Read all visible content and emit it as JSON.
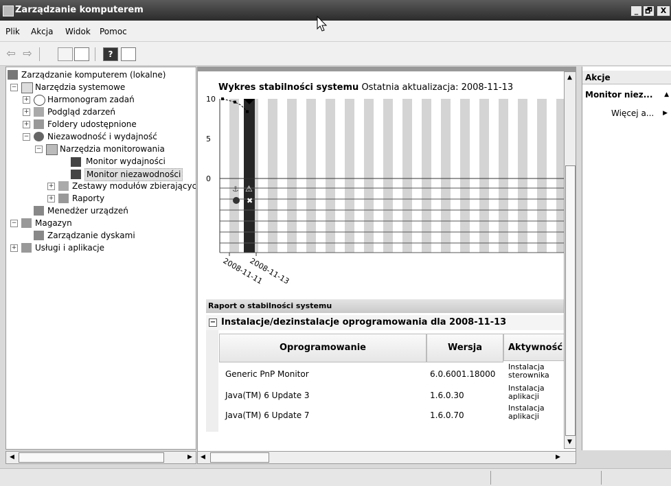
{
  "window": {
    "title": "Zarządzanie komputerem",
    "buttons": {
      "min": "_",
      "max": "🗗",
      "close": "X"
    }
  },
  "menu": [
    "Plik",
    "Akcja",
    "Widok",
    "Pomoc"
  ],
  "toolbar": {
    "back_icon": "back-arrow-icon",
    "forward_icon": "forward-arrow-icon"
  },
  "tree": {
    "items": [
      {
        "label": "Zarządzanie komputerem (lokalne)"
      },
      {
        "label": "Narzędzia systemowe"
      },
      {
        "label": "Harmonogram zadań"
      },
      {
        "label": "Podgląd zdarzeń"
      },
      {
        "label": "Foldery udostępnione"
      },
      {
        "label": "Niezawodność i wydajność"
      },
      {
        "label": "Narzędzia monitorowania"
      },
      {
        "label": "Monitor wydajności"
      },
      {
        "label": "Monitor niezawodności"
      },
      {
        "label": "Zestawy modułów zbierających"
      },
      {
        "label": "Raporty"
      },
      {
        "label": "Menedżer urządzeń"
      },
      {
        "label": "Magazyn"
      },
      {
        "label": "Zarządzanie dyskami"
      },
      {
        "label": "Usługi i aplikacje"
      }
    ]
  },
  "chart_data": {
    "type": "line",
    "title": "Wykres stabilności systemu",
    "subtitle": "Ostatnia aktualizacja: 2008-11-13",
    "ylim": [
      0,
      10
    ],
    "yticks": [
      "10",
      "5",
      "0"
    ],
    "xticks": [
      "2008-11-11",
      "2008-11-13"
    ],
    "series": [
      {
        "values": [
          10,
          9.8,
          9.6,
          9.2,
          8.4
        ]
      }
    ]
  },
  "report": {
    "header": "Raport o stabilności systemu",
    "section": "Instalacje/dezinstalacje oprogramowania dla 2008-11-13",
    "collapse_icon": "−",
    "columns": [
      "Oprogramowanie",
      "Wersja",
      "Aktywność"
    ],
    "rows": [
      {
        "software": "Generic PnP Monitor",
        "version": "6.0.6001.18000",
        "activity": "Instalacja sterownika"
      },
      {
        "software": "Java(TM) 6 Update 3",
        "version": "1.6.0.30",
        "activity": "Instalacja aplikacji"
      },
      {
        "software": "Java(TM) 6 Update 7",
        "version": "1.6.0.70",
        "activity": "Instalacja aplikacji"
      }
    ]
  },
  "actions": {
    "title": "Akcje",
    "section": "Monitor niez...",
    "item": "Więcej a..."
  }
}
